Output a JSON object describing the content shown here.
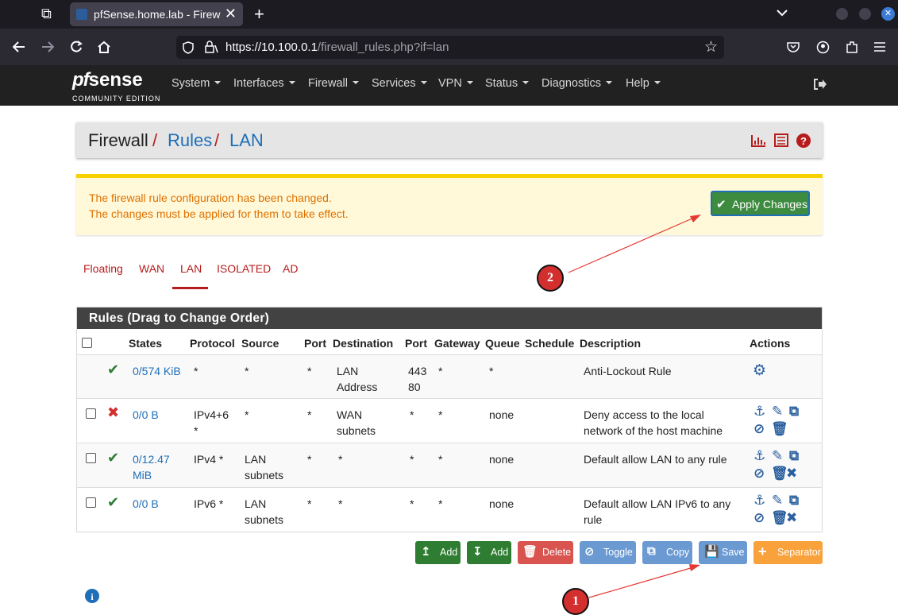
{
  "browser": {
    "tab_title": "pfSense.home.lab - Firew",
    "tab_close": "✕",
    "new_tab": "+",
    "url_host": "https://10.100.0.1",
    "url_path": "/firewall_rules.php?if=lan"
  },
  "header": {
    "logo_pf": "pf",
    "logo_sense": "sense",
    "edition": "COMMUNITY EDITION",
    "menu": [
      "System",
      "Interfaces",
      "Firewall",
      "Services",
      "VPN",
      "Status",
      "Diagnostics",
      "Help"
    ]
  },
  "breadcrumb": {
    "root": "Firewall",
    "sep": "/",
    "level1": "Rules",
    "level2": "LAN"
  },
  "alert": {
    "line1": "The firewall rule configuration has been changed.",
    "line2": "The changes must be applied for them to take effect.",
    "apply_label": "Apply Changes"
  },
  "tabs": [
    "Floating",
    "WAN",
    "LAN",
    "ISOLATED",
    "AD"
  ],
  "active_tab": "LAN",
  "panel_title": "Rules (Drag to Change Order)",
  "columns": [
    "States",
    "Protocol",
    "Source",
    "Port",
    "Destination",
    "Port",
    "Gateway",
    "Queue",
    "Schedule",
    "Description",
    "Actions"
  ],
  "rows": [
    {
      "status": "pass",
      "states1": "0/574 KiB",
      "states2": "",
      "proto1": "*",
      "proto2": "",
      "src1": "*",
      "src2": "",
      "sport": "*",
      "dst1": "LAN",
      "dst2": "Address",
      "dport1": "443",
      "dport2": "80",
      "gw": "*",
      "queue": "*",
      "sched": "",
      "desc1": "Anti-Lockout Rule",
      "desc2": ""
    },
    {
      "status": "block",
      "states1": "0/0 B",
      "states2": "",
      "proto1": "IPv4+6",
      "proto2": "*",
      "src1": "*",
      "src2": "",
      "sport": "*",
      "dst1": "WAN",
      "dst2": "subnets",
      "dport1": "*",
      "dport2": "",
      "gw": "*",
      "queue": "none",
      "sched": "",
      "desc1": "Deny access to the local",
      "desc2": "network of the host machine"
    },
    {
      "status": "pass",
      "states1": "0/12.47",
      "states2": "MiB",
      "proto1": "IPv4 *",
      "proto2": "",
      "src1": "LAN",
      "src2": "subnets",
      "sport": "*",
      "dst1": "*",
      "dst2": "",
      "dport1": "*",
      "dport2": "",
      "gw": "*",
      "queue": "none",
      "sched": "",
      "desc1": "Default allow LAN to any rule",
      "desc2": ""
    },
    {
      "status": "pass",
      "states1": "0/0 B",
      "states2": "",
      "proto1": "IPv6 *",
      "proto2": "",
      "src1": "LAN",
      "src2": "subnets",
      "sport": "*",
      "dst1": "*",
      "dst2": "",
      "dport1": "*",
      "dport2": "",
      "gw": "*",
      "queue": "none",
      "sched": "",
      "desc1": "Default allow LAN IPv6 to any",
      "desc2": "rule"
    }
  ],
  "buttons": {
    "add_top": "Add",
    "add_bottom": "Add",
    "delete": "Delete",
    "toggle": "Toggle",
    "copy": "Copy",
    "save": "Save",
    "separator": "Separator"
  },
  "annotations": {
    "first": "1",
    "second": "2"
  },
  "colors": {
    "green": "#2e7d32",
    "red": "#d32f2f",
    "blue": "#1e6fb8",
    "header": "#212121",
    "save": "#6b9ad3",
    "separator": "#f9a13a"
  }
}
